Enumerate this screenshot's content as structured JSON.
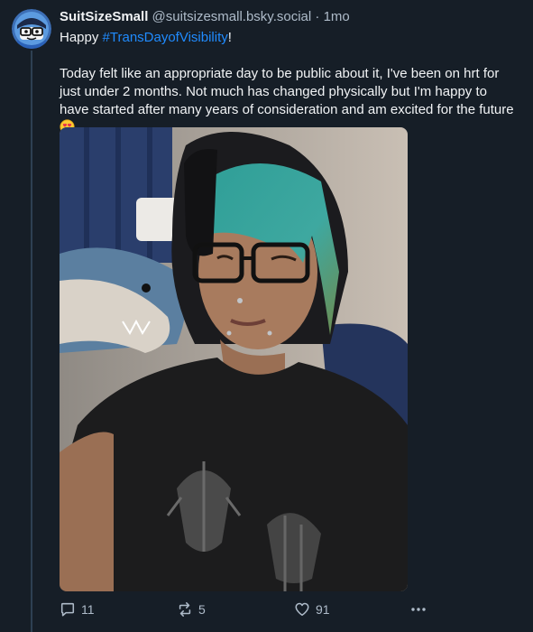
{
  "post": {
    "author": {
      "display_name": "SuitSizeSmall",
      "handle": "@suitsizesmall.bsky.social",
      "separator": "·",
      "time": "1mo",
      "avatar_icon": "avatar-cartoon-icon"
    },
    "line1_prefix": "Happy ",
    "hashtag": "#TransDayofVisibility",
    "line1_suffix": "!",
    "body": "Today felt like an appropriate day to be public about it, I've been on hrt for just under 2 months. Not much has changed physically but I'm happy to have started after many years of consideration and am excited for the future",
    "body_emoji": "smiling-face-with-heart-eyes-emoji",
    "image_icon": "selfie-photo"
  },
  "actions": {
    "replies": "11",
    "reposts": "5",
    "likes": "91",
    "reply_icon": "reply-icon",
    "repost_icon": "repost-icon",
    "like_icon": "heart-icon",
    "more_icon": "more-icon"
  },
  "colors": {
    "background": "#161e27",
    "text": "#f1f3f5",
    "muted": "#aebbc9",
    "link": "#208bfe",
    "thread_line": "#2e4052"
  }
}
